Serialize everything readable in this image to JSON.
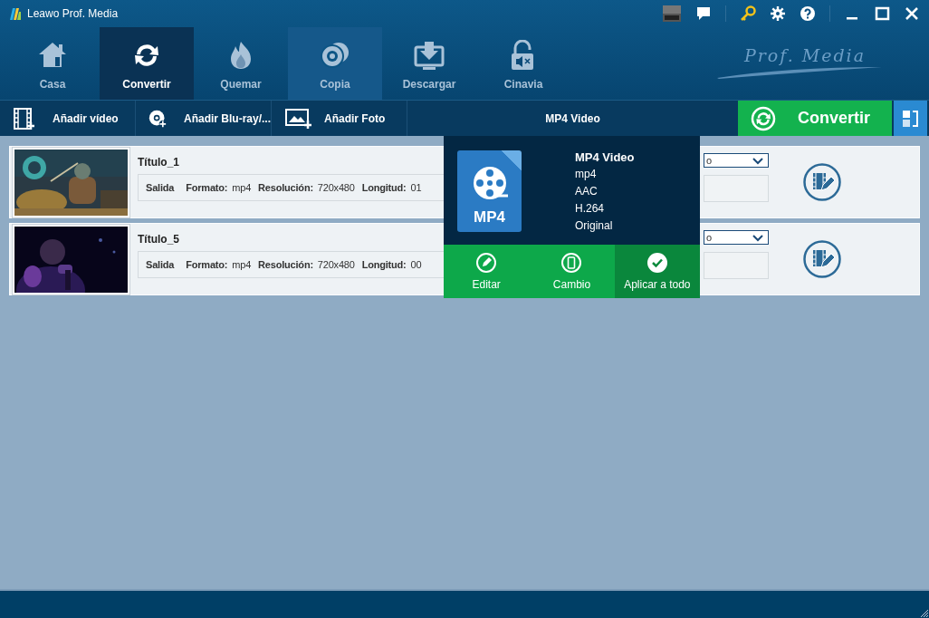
{
  "window": {
    "title": "Leawo Prof. Media"
  },
  "nav_tabs": [
    {
      "label": "Casa",
      "kind": "home",
      "selected": false,
      "hovered": false
    },
    {
      "label": "Convertir",
      "kind": "convert",
      "selected": true,
      "hovered": false
    },
    {
      "label": "Quemar",
      "kind": "burn",
      "selected": false,
      "hovered": false
    },
    {
      "label": "Copia",
      "kind": "copy",
      "selected": false,
      "hovered": true
    },
    {
      "label": "Descargar",
      "kind": "download",
      "selected": false,
      "hovered": false
    },
    {
      "label": "Cinavia",
      "kind": "cinavia",
      "selected": false,
      "hovered": false
    }
  ],
  "brand": "Prof. Media",
  "toolbar": {
    "buttons": [
      {
        "label": "Añadir vídeo",
        "kind": "video"
      },
      {
        "label": "Añadir Blu-ray/...",
        "kind": "disc"
      },
      {
        "label": "Añadir Foto"
      }
    ],
    "format": "MP4 Video",
    "convert_button": "Convertir"
  },
  "videos": [
    {
      "title": "Título_1",
      "output_label": "Salida",
      "format_label": "Formato:",
      "format": "mp4",
      "resolution_label": "Resolución:",
      "resolution": "720x480",
      "length_label": "Longitud:",
      "length": "01",
      "subtitle_value": "o"
    },
    {
      "title": "Título_5",
      "output_label": "Salida",
      "format_label": "Formato:",
      "format": "mp4",
      "resolution_label": "Resolución:",
      "resolution": "720x480",
      "length_label": "Longitud:",
      "length": "00",
      "subtitle_value": "o"
    }
  ],
  "popup": {
    "badge": "MP4",
    "name": "MP4 Video",
    "details": [
      "mp4",
      "AAC",
      "H.264",
      "Original"
    ],
    "actions": [
      {
        "label": "Editar",
        "kind": "edit",
        "selected": false
      },
      {
        "label": "Cambio",
        "kind": "device",
        "selected": false
      },
      {
        "label": "Aplicar a todo",
        "kind": "apply",
        "selected": true
      }
    ]
  }
}
